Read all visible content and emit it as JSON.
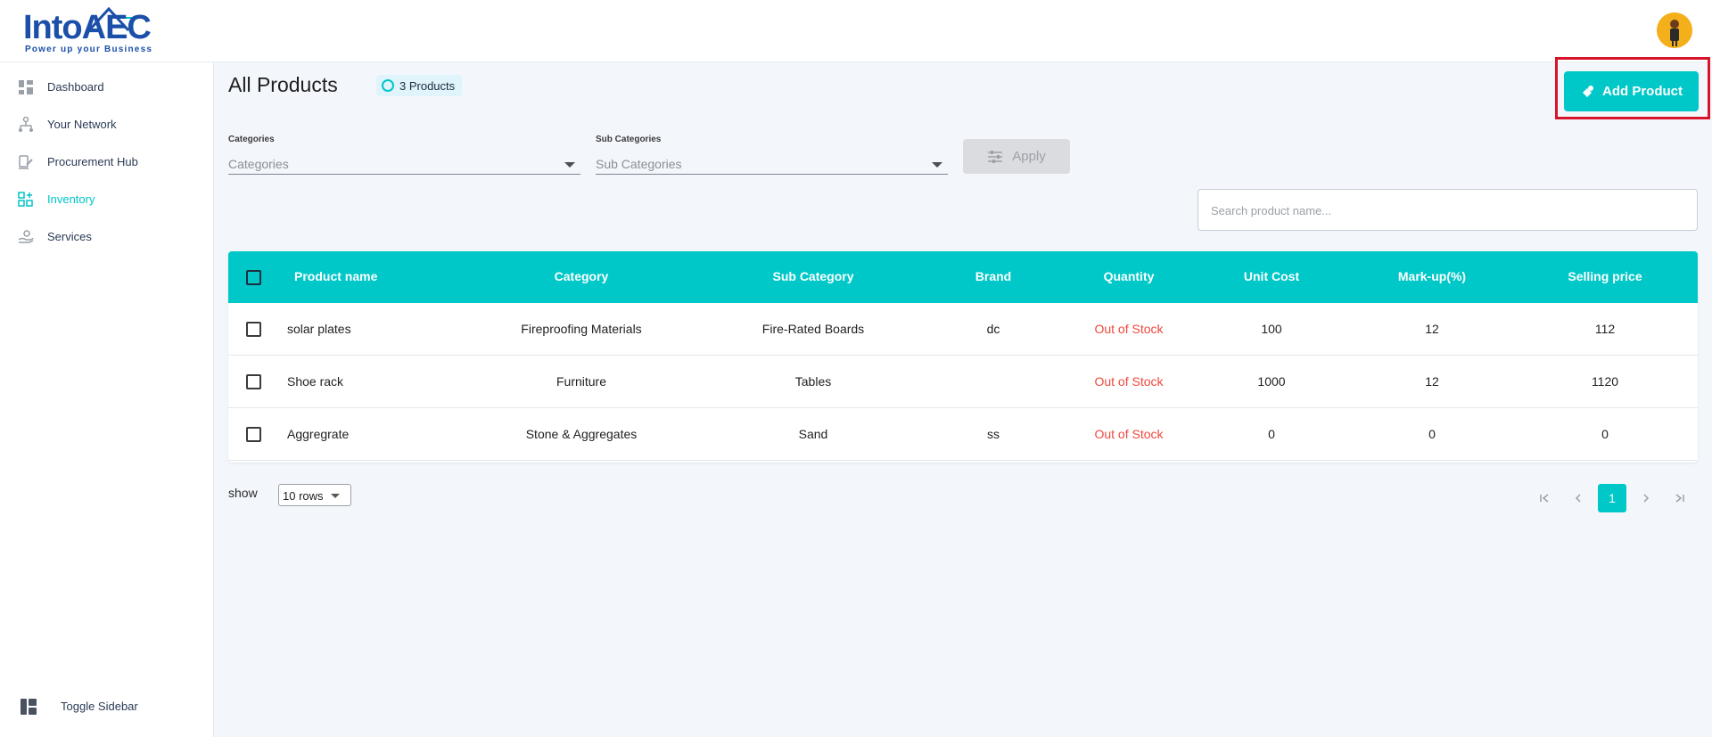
{
  "brand": {
    "logo_text": "IntoAEC",
    "tagline": "Power up your Business"
  },
  "sidebar": {
    "items": [
      {
        "label": "Dashboard",
        "icon": "dashboard-icon",
        "active": false
      },
      {
        "label": "Your Network",
        "icon": "network-icon",
        "active": false
      },
      {
        "label": "Procurement Hub",
        "icon": "procurement-icon",
        "active": false
      },
      {
        "label": "Inventory",
        "icon": "inventory-icon",
        "active": true
      },
      {
        "label": "Services",
        "icon": "services-icon",
        "active": false
      }
    ],
    "toggle_label": "Toggle Sidebar"
  },
  "page": {
    "title": "All Products",
    "count_badge": "3 Products",
    "add_button": "Add Product"
  },
  "filters": {
    "categories_label": "Categories",
    "categories_placeholder": "Categories",
    "subcategories_label": "Sub Categories",
    "subcategories_placeholder": "Sub Categories",
    "apply_label": "Apply"
  },
  "search": {
    "placeholder": "Search product name..."
  },
  "table": {
    "headers": {
      "product_name": "Product name",
      "category": "Category",
      "sub_category": "Sub Category",
      "brand": "Brand",
      "quantity": "Quantity",
      "unit_cost": "Unit Cost",
      "markup": "Mark-up(%)",
      "selling_price": "Selling price"
    },
    "rows": [
      {
        "product_name": "solar plates",
        "category": "Fireproofing Materials",
        "sub_category": "Fire-Rated Boards",
        "brand": "dc",
        "quantity": "Out of Stock",
        "unit_cost": "100",
        "markup": "12",
        "selling_price": "112"
      },
      {
        "product_name": "Shoe rack",
        "category": "Furniture",
        "sub_category": "Tables",
        "brand": "",
        "quantity": "Out of Stock",
        "unit_cost": "1000",
        "markup": "12",
        "selling_price": "1120"
      },
      {
        "product_name": "Aggregrate",
        "category": "Stone & Aggregates",
        "sub_category": "Sand",
        "brand": "ss",
        "quantity": "Out of Stock",
        "unit_cost": "0",
        "markup": "0",
        "selling_price": "0"
      }
    ]
  },
  "pagination": {
    "show_label": "show",
    "rows_per_page": "10 rows",
    "current_page": "1",
    "first_icon": "first-page-icon",
    "prev_icon": "prev-page-icon",
    "next_icon": "next-page-icon",
    "last_icon": "last-page-icon"
  },
  "colors": {
    "accent": "#00c8c8",
    "danger": "#f0483b",
    "highlight": "#d7152a",
    "brand_blue": "#1b4fa8"
  }
}
